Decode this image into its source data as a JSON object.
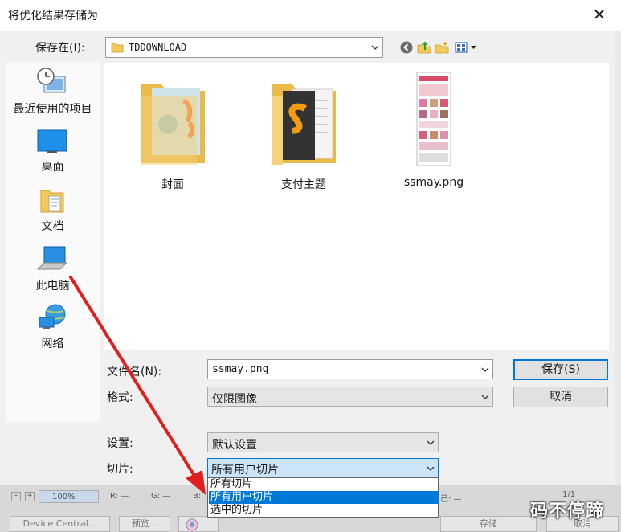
{
  "dialog": {
    "title": "将优化结果存储为",
    "close_glyph": "✕"
  },
  "savein": {
    "label": "保存在(I):",
    "value": "TDDOWNLOAD"
  },
  "toolbar_icons": [
    "back-icon",
    "up-folder-icon",
    "new-folder-icon",
    "view-menu-icon"
  ],
  "places": [
    {
      "label": "最近使用的项目",
      "icon": "recent-items-icon"
    },
    {
      "label": "桌面",
      "icon": "desktop-icon"
    },
    {
      "label": "文档",
      "icon": "documents-icon"
    },
    {
      "label": "此电脑",
      "icon": "this-pc-icon"
    },
    {
      "label": "网络",
      "icon": "network-icon"
    }
  ],
  "files": [
    {
      "name": "封面",
      "type": "folder"
    },
    {
      "name": "支付主题",
      "type": "folder"
    },
    {
      "name": "ssmay.png",
      "type": "image"
    }
  ],
  "form": {
    "filename_label": "文件名(N):",
    "filename_value": "ssmay.png",
    "format_label": "格式:",
    "format_value": "仅限图像",
    "settings_label": "设置:",
    "settings_value": "默认设置",
    "slice_label": "切片:",
    "slice_value": "所有用户切片",
    "save_button": "保存(S)",
    "cancel_button": "取消"
  },
  "slice_options": [
    {
      "label": "所有切片",
      "selected": false
    },
    {
      "label": "所有用户切片",
      "selected": true
    },
    {
      "label": "选中的切片",
      "selected": false
    }
  ],
  "background_app": {
    "zoom": "100%",
    "r_label": "R: —",
    "g_label": "G: —",
    "b_label": "B:",
    "page_indicator": "1/1",
    "device_central": "Device Central...",
    "preview": "预览...",
    "store_button": "存储",
    "cancel_button": "取消",
    "partial_text": "己: —"
  },
  "watermark": "码不停蹄",
  "colors": {
    "accent": "#0078d7",
    "annotation_arrow": "#e02020",
    "folder_yellow": "#f3c95a"
  }
}
